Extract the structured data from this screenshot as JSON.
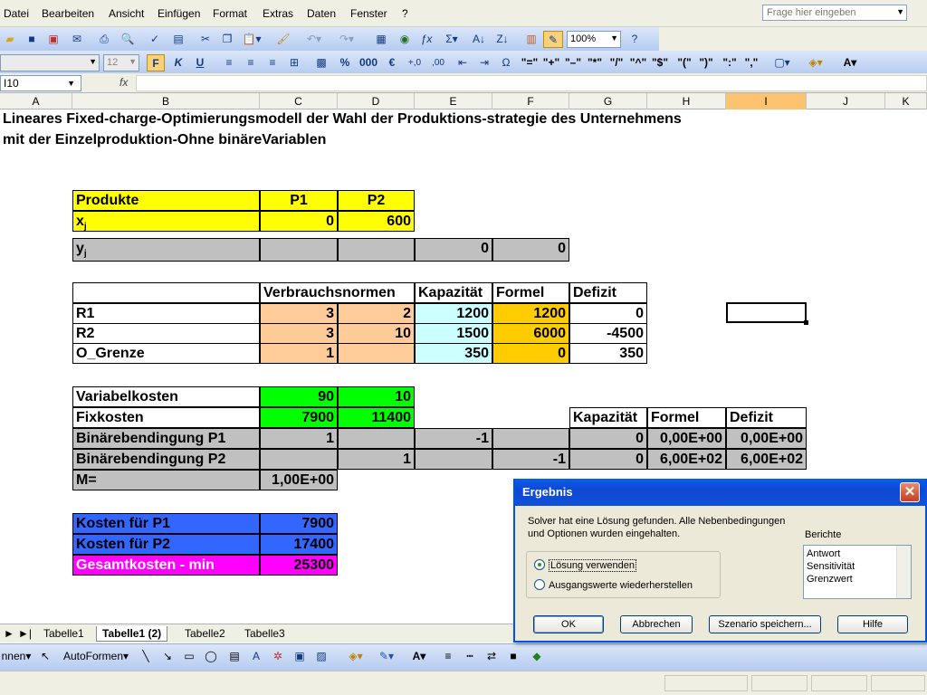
{
  "menu": {
    "items": [
      "Datei",
      "Bearbeiten",
      "Ansicht",
      "Einfügen",
      "Format",
      "Extras",
      "Daten",
      "Fenster",
      "?"
    ],
    "help_placeholder": "Frage hier eingeben"
  },
  "toolbar": {
    "zoom": "100%",
    "font_size": "12",
    "bold": "F",
    "italic": "K",
    "underline": "U",
    "percent": "%",
    "thousands": "000",
    "euro": "€",
    "ops": [
      "\"=\"",
      "\"+\"",
      "\"–\"",
      "\"*\"",
      "\"/\"",
      "\"^\"",
      "\"$\"",
      "\"(\"",
      "\")\"",
      "\":\"",
      "\",\""
    ]
  },
  "formula_bar": {
    "name_box": "I10",
    "fx": "fx",
    "value": ""
  },
  "columns": [
    "A",
    "B",
    "C",
    "D",
    "E",
    "F",
    "G",
    "H",
    "I",
    "J",
    "K"
  ],
  "selected_column": "I",
  "title": {
    "line1": "Lineares Fixed-charge-Optimierungsmodell der Wahl der Produktions-strategie des Unternehmens",
    "line2": "mit der Einzelproduktion-Ohne binäreVariablen"
  },
  "products": {
    "header": "Produkte",
    "p1": "P1",
    "p2": "P2",
    "xj_label": "x",
    "xj_sub": "j",
    "x1": "0",
    "x2": "600",
    "yj_label": "y",
    "yj_sub": "j",
    "y1": "0",
    "y2": "0"
  },
  "constraints": {
    "h_verbrauch": "Verbrauchsnormen",
    "h_kapazitaet": "Kapazität",
    "h_formel": "Formel",
    "h_defizit": "Defizit",
    "rows": [
      {
        "name": "R1",
        "c": "3",
        "d": "2",
        "kap": "1200",
        "formel": "1200",
        "def": "0"
      },
      {
        "name": "R2",
        "c": "3",
        "d": "10",
        "kap": "1500",
        "formel": "6000",
        "def": "-4500"
      },
      {
        "name": "O_Grenze",
        "c": "1",
        "d": "",
        "kap": "350",
        "formel": "0",
        "def": "350"
      }
    ]
  },
  "costs": {
    "variabel_label": "Variabelkosten",
    "var_p1": "90",
    "var_p2": "10",
    "fix_label": "Fixkosten",
    "fix_p1": "7900",
    "fix_p2": "11400",
    "h_kapazitaet": "Kapazität",
    "h_formel": "Formel",
    "h_defizit": "Defizit",
    "bin1_label": "Binärebendingung P1",
    "bin1_c": "1",
    "bin1_e": "-1",
    "bin1_kap": "0",
    "bin1_formel": "0,00E+00",
    "bin1_def": "0,00E+00",
    "bin2_label": "Binärebendingung P2",
    "bin2_d": "1",
    "bin2_f": "-1",
    "bin2_kap": "0",
    "bin2_formel": "6,00E+02",
    "bin2_def": "6,00E+02",
    "m_label": "M=",
    "m_value": "1,00E+00"
  },
  "totals": {
    "p1_label": "Kosten für P1",
    "p1": "7900",
    "p2_label": "Kosten für P2",
    "p2": "17400",
    "sum_label": "Gesamtkosten - min",
    "sum": "25300"
  },
  "sheets": [
    "Tabelle1",
    "Tabelle1 (2)",
    "Tabelle2",
    "Tabelle3"
  ],
  "drawbar": {
    "draw": "nnen",
    "autoformen": "AutoFormen"
  },
  "dialog": {
    "title": "Ergebnis",
    "message": "Solver hat eine Lösung gefunden. Alle Nebenbedingungen und Optionen wurden eingehalten.",
    "option1": "Lösung verwenden",
    "option2": "Ausgangswerte wiederherstellen",
    "berichte_label": "Berichte",
    "reports": [
      "Antwort",
      "Sensitivität",
      "Grenzwert"
    ],
    "ok": "OK",
    "cancel": "Abbrechen",
    "scenario": "Szenario speichern...",
    "help": "Hilfe"
  },
  "colors": {
    "yellow": "#ffff00",
    "gray": "#c0c0c0",
    "peach": "#ffcc99",
    "lightblue": "#ccffff",
    "orange": "#ffcc00",
    "green": "#00ff00",
    "blue": "#3366ff",
    "magenta": "#ff00ff",
    "selected_header": "#fcc370"
  }
}
